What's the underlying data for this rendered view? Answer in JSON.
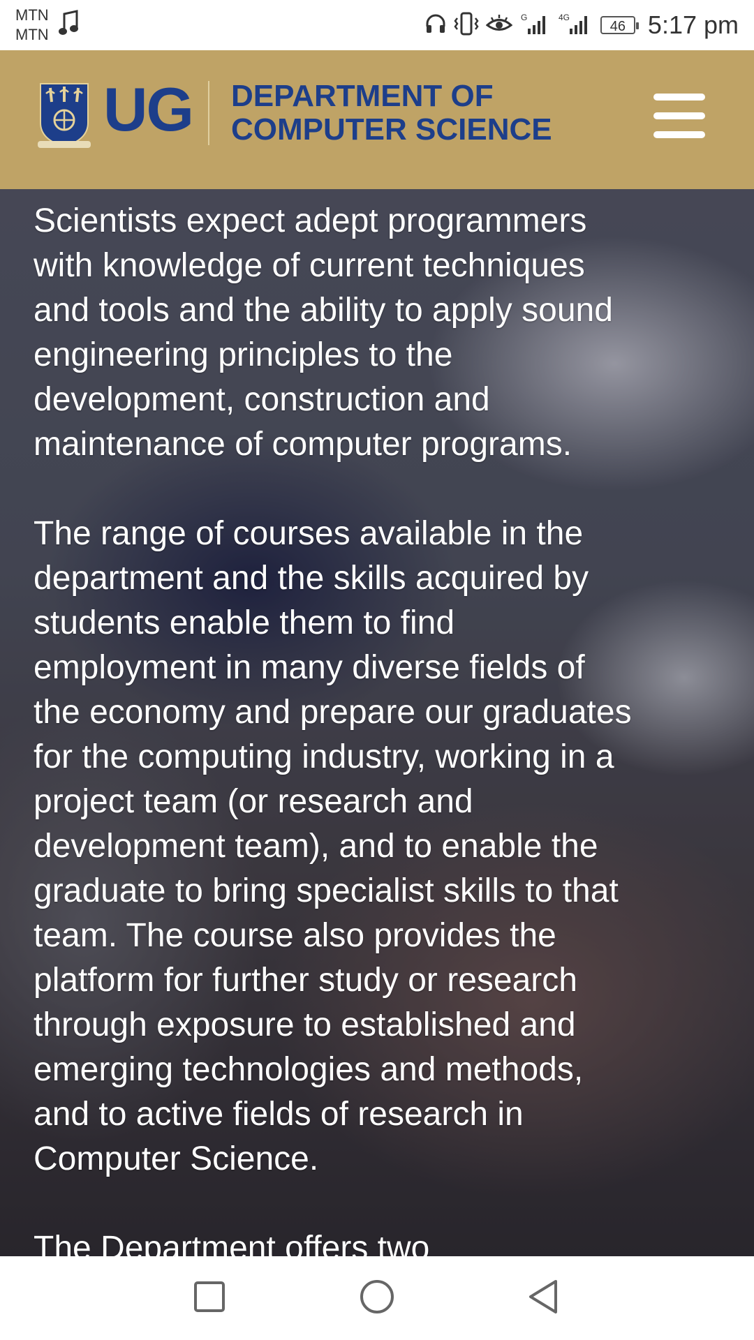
{
  "status_bar": {
    "carrier_1": "MTN",
    "carrier_2": "MTN",
    "network_1": "G",
    "network_2": "4G",
    "battery_level": "46",
    "time": "5:17 pm",
    "icons": [
      "music-note-icon",
      "headphones-icon",
      "vibrate-icon",
      "eye-comfort-icon",
      "signal-icon",
      "battery-icon"
    ]
  },
  "header": {
    "logo_text": "UG",
    "department_line_1": "DEPARTMENT OF",
    "department_line_2": "COMPUTER SCIENCE",
    "colors": {
      "background": "#bfa366",
      "brand_blue": "#1d3e8a"
    },
    "menu_icon": "hamburger-menu-icon"
  },
  "article": {
    "paragraph_1": "Scientists expect adept programmers\nwith knowledge of current techniques\nand tools and the ability to apply sound\nengineering principles to the\ndevelopment, construction and\nmaintenance of computer programs.",
    "paragraph_2": "The range of courses available in the\ndepartment and the skills acquired by\nstudents enable them to find\nemployment in many diverse fields of\nthe economy and prepare our graduates\nfor the computing industry, working in a\nproject team (or research and\ndevelopment team), and to enable the\ngraduate to bring specialist skills to that\nteam. The course also provides the\nplatform for further study or research\nthrough exposure to established and\nemerging technologies and methods,\nand to active fields of research in\nComputer Science.",
    "paragraph_3_partial": "The Department offers two"
  },
  "nav_bar": {
    "icons": [
      "recent-apps-icon",
      "home-icon",
      "back-icon"
    ]
  }
}
